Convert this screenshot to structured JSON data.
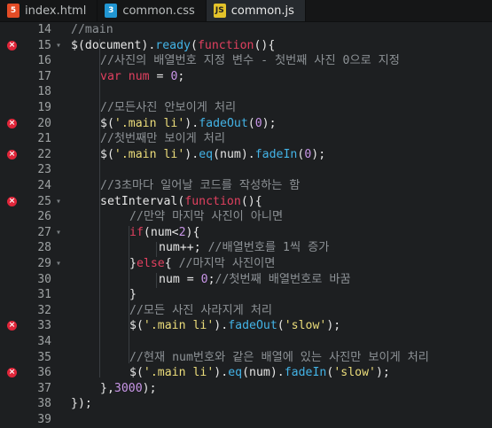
{
  "tabs": [
    {
      "label": "index.html",
      "icon": "html-file-icon",
      "badge": "5"
    },
    {
      "label": "common.css",
      "icon": "css-file-icon",
      "badge": "3"
    },
    {
      "label": "common.js",
      "icon": "js-file-icon",
      "badge": "JS"
    }
  ],
  "active_tab": "common.js",
  "lines": [
    {
      "n": "14",
      "err": false,
      "fold": false,
      "indent": 0,
      "tokens": [
        [
          "cm",
          "//main"
        ]
      ]
    },
    {
      "n": "15",
      "err": true,
      "fold": true,
      "indent": 0,
      "tokens": [
        [
          "pl",
          "$(document)."
        ],
        [
          "fn",
          "ready"
        ],
        [
          "pl",
          "("
        ],
        [
          "kw",
          "function"
        ],
        [
          "pl",
          "(){"
        ]
      ]
    },
    {
      "n": "16",
      "err": false,
      "fold": false,
      "indent": 1,
      "tokens": [
        [
          "cm",
          "//사진의 배열번호 지정 변수 - 첫번째 사진 0으로 지정"
        ]
      ]
    },
    {
      "n": "17",
      "err": false,
      "fold": false,
      "indent": 1,
      "tokens": [
        [
          "kw",
          "var"
        ],
        [
          "pl",
          " "
        ],
        [
          "kw",
          "num"
        ],
        [
          "pl",
          " = "
        ],
        [
          "num",
          "0"
        ],
        [
          "pl",
          ";"
        ]
      ]
    },
    {
      "n": "18",
      "err": false,
      "fold": false,
      "indent": 0,
      "tokens": []
    },
    {
      "n": "19",
      "err": false,
      "fold": false,
      "indent": 1,
      "tokens": [
        [
          "cm",
          "//모든사진 안보이게 처리"
        ]
      ]
    },
    {
      "n": "20",
      "err": true,
      "fold": false,
      "indent": 1,
      "tokens": [
        [
          "pl",
          "$("
        ],
        [
          "str",
          "'.main li'"
        ],
        [
          "pl",
          ")."
        ],
        [
          "fn",
          "fadeOut"
        ],
        [
          "pl",
          "("
        ],
        [
          "num",
          "0"
        ],
        [
          "pl",
          ");"
        ]
      ]
    },
    {
      "n": "21",
      "err": false,
      "fold": false,
      "indent": 1,
      "tokens": [
        [
          "cm",
          "//첫번째만 보이게 처리"
        ]
      ]
    },
    {
      "n": "22",
      "err": true,
      "fold": false,
      "indent": 1,
      "tokens": [
        [
          "pl",
          "$("
        ],
        [
          "str",
          "'.main li'"
        ],
        [
          "pl",
          ")."
        ],
        [
          "fn",
          "eq"
        ],
        [
          "pl",
          "(num)."
        ],
        [
          "fn",
          "fadeIn"
        ],
        [
          "pl",
          "("
        ],
        [
          "num",
          "0"
        ],
        [
          "pl",
          ");"
        ]
      ]
    },
    {
      "n": "23",
      "err": false,
      "fold": false,
      "indent": 0,
      "tokens": []
    },
    {
      "n": "24",
      "err": false,
      "fold": false,
      "indent": 1,
      "tokens": [
        [
          "cm",
          "//3초마다 일어날 코드를 작성하는 함"
        ]
      ]
    },
    {
      "n": "25",
      "err": true,
      "fold": true,
      "indent": 1,
      "tokens": [
        [
          "pl",
          "setInterval("
        ],
        [
          "kw",
          "function"
        ],
        [
          "pl",
          "(){"
        ]
      ]
    },
    {
      "n": "26",
      "err": false,
      "fold": false,
      "indent": 2,
      "tokens": [
        [
          "cm",
          "//만약 마지막 사진이 아니면"
        ]
      ]
    },
    {
      "n": "27",
      "err": false,
      "fold": true,
      "indent": 2,
      "tokens": [
        [
          "kw",
          "if"
        ],
        [
          "pl",
          "(num<"
        ],
        [
          "num",
          "2"
        ],
        [
          "pl",
          "){"
        ]
      ]
    },
    {
      "n": "28",
      "err": false,
      "fold": false,
      "indent": 3,
      "tokens": [
        [
          "pl",
          "num++; "
        ],
        [
          "cm",
          "//배열번호를 1씩 증가"
        ]
      ]
    },
    {
      "n": "29",
      "err": false,
      "fold": true,
      "indent": 2,
      "tokens": [
        [
          "pl",
          "}"
        ],
        [
          "kw",
          "else"
        ],
        [
          "pl",
          "{ "
        ],
        [
          "cm",
          "//마지막 사진이면"
        ]
      ]
    },
    {
      "n": "30",
      "err": false,
      "fold": false,
      "indent": 3,
      "tokens": [
        [
          "pl",
          "num = "
        ],
        [
          "num",
          "0"
        ],
        [
          "pl",
          ";"
        ],
        [
          "cm",
          "//첫번째 배열번호로 바꿈"
        ]
      ]
    },
    {
      "n": "31",
      "err": false,
      "fold": false,
      "indent": 2,
      "tokens": [
        [
          "pl",
          "}"
        ]
      ]
    },
    {
      "n": "32",
      "err": false,
      "fold": false,
      "indent": 2,
      "tokens": [
        [
          "cm",
          "//모든 사진 사라지게 처리"
        ]
      ]
    },
    {
      "n": "33",
      "err": true,
      "fold": false,
      "indent": 2,
      "tokens": [
        [
          "pl",
          "$("
        ],
        [
          "str",
          "'.main li'"
        ],
        [
          "pl",
          ")."
        ],
        [
          "fn",
          "fadeOut"
        ],
        [
          "pl",
          "("
        ],
        [
          "str",
          "'slow'"
        ],
        [
          "pl",
          ");"
        ]
      ]
    },
    {
      "n": "34",
      "err": false,
      "fold": false,
      "indent": 0,
      "tokens": []
    },
    {
      "n": "35",
      "err": false,
      "fold": false,
      "indent": 2,
      "tokens": [
        [
          "cm",
          "//현재 num번호와 같은 배열에 있는 사진만 보이게 처리"
        ]
      ]
    },
    {
      "n": "36",
      "err": true,
      "fold": false,
      "indent": 2,
      "tokens": [
        [
          "pl",
          "$("
        ],
        [
          "str",
          "'.main li'"
        ],
        [
          "pl",
          ")."
        ],
        [
          "fn",
          "eq"
        ],
        [
          "pl",
          "(num)."
        ],
        [
          "fn",
          "fadeIn"
        ],
        [
          "pl",
          "("
        ],
        [
          "str",
          "'slow'"
        ],
        [
          "pl",
          ");"
        ]
      ]
    },
    {
      "n": "37",
      "err": false,
      "fold": false,
      "indent": 1,
      "tokens": [
        [
          "pl",
          "},"
        ],
        [
          "num",
          "3000"
        ],
        [
          "pl",
          ");"
        ]
      ]
    },
    {
      "n": "38",
      "err": false,
      "fold": false,
      "indent": 0,
      "tokens": [
        [
          "pl",
          "});"
        ]
      ]
    },
    {
      "n": "39",
      "err": false,
      "fold": false,
      "indent": 0,
      "tokens": []
    }
  ],
  "colors": {
    "background": "#1d1f21",
    "comment": "#8d9296",
    "keyword": "#e0405f",
    "function": "#43b3e6",
    "string": "#ebdc7a",
    "number": "#c996e8",
    "error_marker": "#e0263a"
  }
}
